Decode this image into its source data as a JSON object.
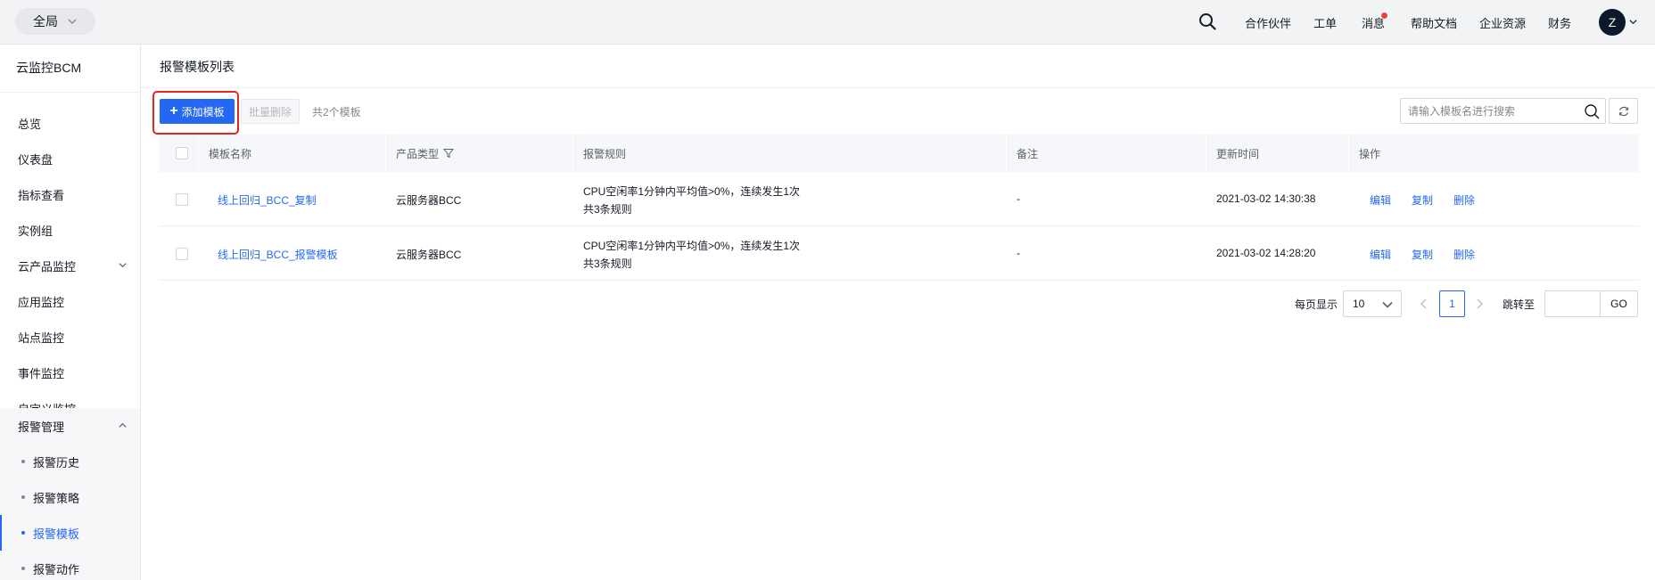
{
  "topbar": {
    "region": "全局",
    "nav": [
      "合作伙伴",
      "工单",
      "消息",
      "帮助文档",
      "企业资源",
      "财务"
    ],
    "avatar_initial": "Z"
  },
  "sidebar": {
    "title": "云监控BCM",
    "items": [
      "总览",
      "仪表盘",
      "指标查看",
      "实例组",
      "云产品监控",
      "应用监控",
      "站点监控",
      "事件监控",
      "自定义监控",
      "报警管理"
    ],
    "sub_items": [
      "报警历史",
      "报警策略",
      "报警模板",
      "报警动作"
    ],
    "active_sub": "报警模板"
  },
  "main": {
    "title": "报警模板列表",
    "add_button": "添加模板",
    "batch_delete": "批量删除",
    "count_text": "共2个模板",
    "search_placeholder": "请输入模板名进行搜索"
  },
  "table": {
    "headers": [
      "模板名称",
      "产品类型",
      "报警规则",
      "备注",
      "更新时间",
      "操作"
    ],
    "rows": [
      {
        "name": "线上回归_BCC_复制",
        "product": "云服务器BCC",
        "rule_line1": "CPU空闲率1分钟内平均值>0%，连续发生1次",
        "rule_line2": "共3条规则",
        "remark": "-",
        "updated": "2021-03-02 14:30:38"
      },
      {
        "name": "线上回归_BCC_报警模板",
        "product": "云服务器BCC",
        "rule_line1": "CPU空闲率1分钟内平均值>0%，连续发生1次",
        "rule_line2": "共3条规则",
        "remark": "-",
        "updated": "2021-03-02 14:28:20"
      }
    ],
    "actions": [
      "编辑",
      "复制",
      "删除"
    ]
  },
  "pagination": {
    "per_page_label": "每页显示",
    "per_page_value": "10",
    "current_page": "1",
    "jump_label": "跳转至",
    "go_label": "GO"
  }
}
